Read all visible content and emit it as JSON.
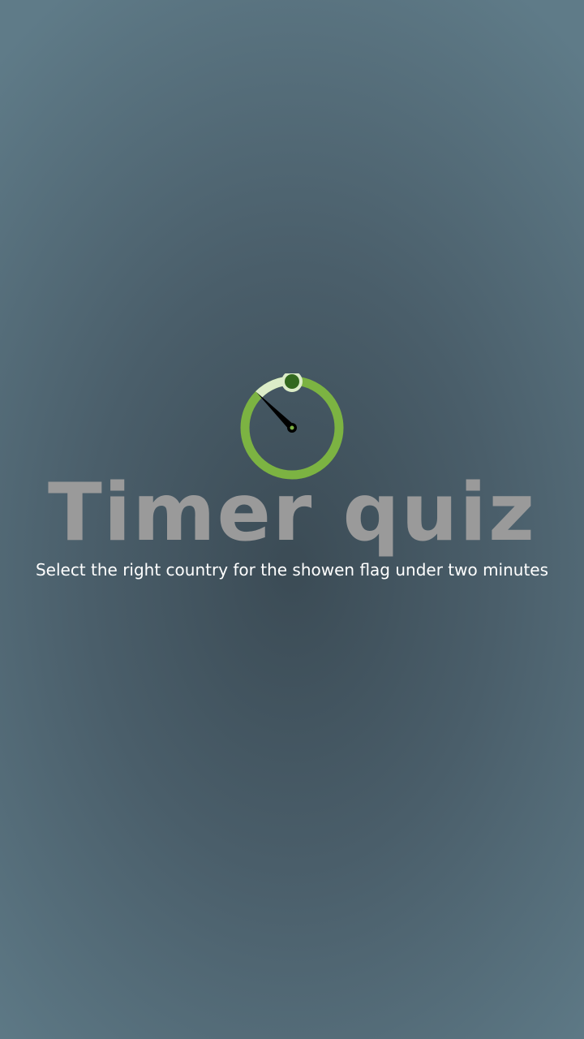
{
  "splash": {
    "title": "Timer quiz",
    "subtitle": "Select the right country for the showen flag under two minutes",
    "icon": "stopwatch-icon"
  },
  "colors": {
    "background_center": "#3b4b55",
    "background_edge": "#5f7b88",
    "title": "#9a9a9a",
    "subtitle": "#ffffff",
    "timer_ring": "#7cb342",
    "timer_remaining_arc": "#dcedc8",
    "timer_knob": "#33691e",
    "timer_hand": "#000000"
  }
}
